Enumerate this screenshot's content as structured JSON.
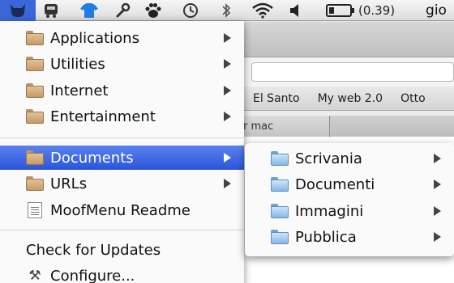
{
  "menubar": {
    "battery_label": "(0.39)",
    "user_label": "gio"
  },
  "background_window": {
    "bookmarks": [
      "El Santo",
      "My web 2.0",
      "Otto"
    ],
    "tab_label": "r mac"
  },
  "main_menu": {
    "items": [
      {
        "label": "Applications"
      },
      {
        "label": "Utilities"
      },
      {
        "label": "Internet"
      },
      {
        "label": "Entertainment"
      },
      {
        "label": "Documents"
      },
      {
        "label": "URLs"
      },
      {
        "label": "MoofMenu Readme"
      },
      {
        "label": "Check for Updates"
      },
      {
        "label": "Configure..."
      }
    ]
  },
  "sub_menu": {
    "items": [
      {
        "label": "Scrivania"
      },
      {
        "label": "Documenti"
      },
      {
        "label": "Immagini"
      },
      {
        "label": "Pubblica"
      }
    ]
  },
  "colors": {
    "highlight": "#2a55d8",
    "folder_tan": "#c49a68",
    "folder_blue": "#86b8e6"
  }
}
